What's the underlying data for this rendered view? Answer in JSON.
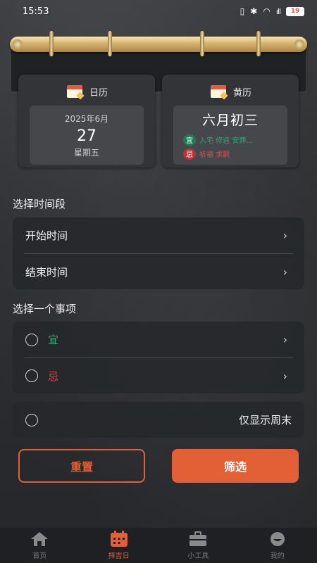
{
  "status_bar": {
    "time": "15:53",
    "battery": "19",
    "signal": "ıll"
  },
  "calendar_card": {
    "title": "日历",
    "month": "2025年6月",
    "day": "27",
    "weekday": "星期五"
  },
  "lunar_card": {
    "title": "黄历",
    "lunar_date": "六月初三",
    "yi_badge": "宜",
    "yi_text": "入宅 修造 安葬...",
    "ji_badge": "忌",
    "ji_text": "祈福 求嗣"
  },
  "time_section": {
    "title": "选择时间段",
    "start_label": "开始时间",
    "end_label": "结束时间"
  },
  "event_section": {
    "title": "选择一个事项",
    "yi_label": "宜",
    "ji_label": "忌"
  },
  "weekend": {
    "label": "仅显示周末"
  },
  "buttons": {
    "reset": "重置",
    "filter": "筛选"
  },
  "tabbar": {
    "items": [
      {
        "label": "首页",
        "icon": "home-icon"
      },
      {
        "label": "择吉日",
        "icon": "calendar-icon"
      },
      {
        "label": "小工具",
        "icon": "toolbox-icon"
      },
      {
        "label": "我的",
        "icon": "profile-icon"
      }
    ],
    "active_index": 1
  },
  "colors": {
    "accent": "#e35f35",
    "yi": "#2fa874",
    "ji": "#d54b55"
  }
}
